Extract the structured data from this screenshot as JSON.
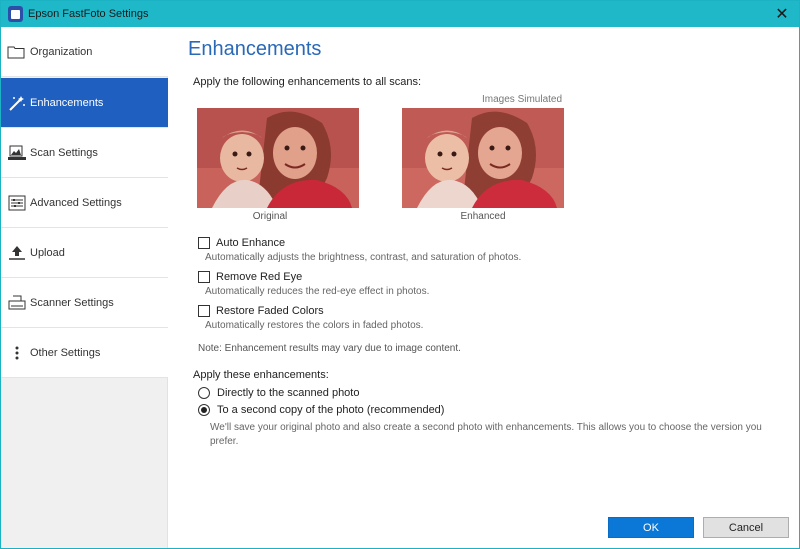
{
  "window": {
    "title": "Epson FastFoto Settings",
    "accent": "#1fb8c9"
  },
  "sidebar": {
    "items": [
      {
        "label": "Organization",
        "icon": "folder-icon",
        "active": false
      },
      {
        "label": "Enhancements",
        "icon": "magic-wand-icon",
        "active": true
      },
      {
        "label": "Scan Settings",
        "icon": "scan-icon",
        "active": false
      },
      {
        "label": "Advanced Settings",
        "icon": "sliders-icon",
        "active": false
      },
      {
        "label": "Upload",
        "icon": "upload-icon",
        "active": false
      },
      {
        "label": "Scanner Settings",
        "icon": "scanner-icon",
        "active": false
      },
      {
        "label": "Other Settings",
        "icon": "more-vertical-icon",
        "active": false
      }
    ]
  },
  "main": {
    "title": "Enhancements",
    "intro": "Apply the following enhancements to all scans:",
    "simulated": "Images Simulated",
    "images": {
      "original": "Original",
      "enhanced": "Enhanced"
    },
    "options": [
      {
        "label": "Auto Enhance",
        "desc": "Automatically adjusts the brightness, contrast, and saturation of photos.",
        "checked": false
      },
      {
        "label": "Remove Red Eye",
        "desc": "Automatically reduces the red-eye effect in photos.",
        "checked": false
      },
      {
        "label": "Restore Faded Colors",
        "desc": "Automatically restores the colors in faded photos.",
        "checked": false
      }
    ],
    "note": "Note: Enhancement results may vary due to image content.",
    "apply_label": "Apply these enhancements:",
    "radios": [
      {
        "label": "Directly to the scanned photo",
        "checked": false
      },
      {
        "label": "To a second copy of the photo (recommended)",
        "checked": true
      }
    ],
    "radio_desc": "We'll save your original photo and also create a second photo with enhancements. This allows you to choose the version you prefer."
  },
  "buttons": {
    "ok": "OK",
    "cancel": "Cancel"
  }
}
